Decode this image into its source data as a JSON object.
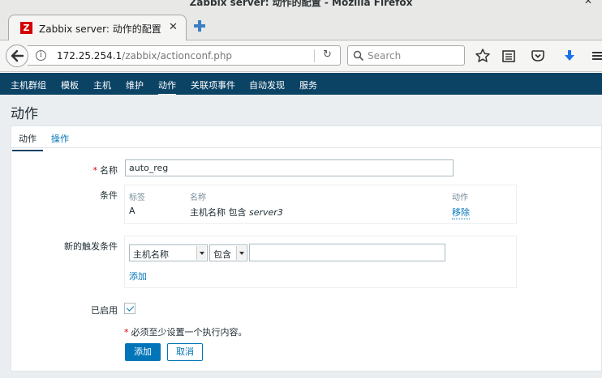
{
  "window": {
    "title": "Zabbix server: 动作的配置 - Mozilla Firefox"
  },
  "browser": {
    "tab_title": "Zabbix server: 动作的配置",
    "favicon_letter": "Z",
    "url_host": "172.25.254.1",
    "url_path": "/zabbix/actionconf.php",
    "search_placeholder": "Search"
  },
  "menu": {
    "items": [
      "主机群组",
      "模板",
      "主机",
      "维护",
      "动作",
      "关联项事件",
      "自动发现",
      "服务"
    ],
    "active_index": 4
  },
  "page": {
    "title": "动作",
    "tabs": [
      "动作",
      "操作"
    ]
  },
  "form": {
    "name_label": "名称",
    "name_value": "auto_reg",
    "conditions_label": "条件",
    "conditions": {
      "headers": [
        "标签",
        "名称",
        "动作"
      ],
      "rows": [
        {
          "tag": "A",
          "name_prefix": "主机名称 包含",
          "name_value": "server3",
          "action": "移除"
        }
      ]
    },
    "new_condition_label": "新的触发条件",
    "new_condition": {
      "type_select": "主机名称",
      "operator_select": "包含",
      "value": "",
      "add_link": "添加"
    },
    "enabled_label": "已启用",
    "enabled": true,
    "warning": "必须至少设置一个执行内容。",
    "add_button": "添加",
    "cancel_button": "取消"
  },
  "colors": {
    "header_bg": "#0b4365",
    "link": "#0275b8",
    "required": "#d40000",
    "page_bg": "#ebeef0"
  }
}
